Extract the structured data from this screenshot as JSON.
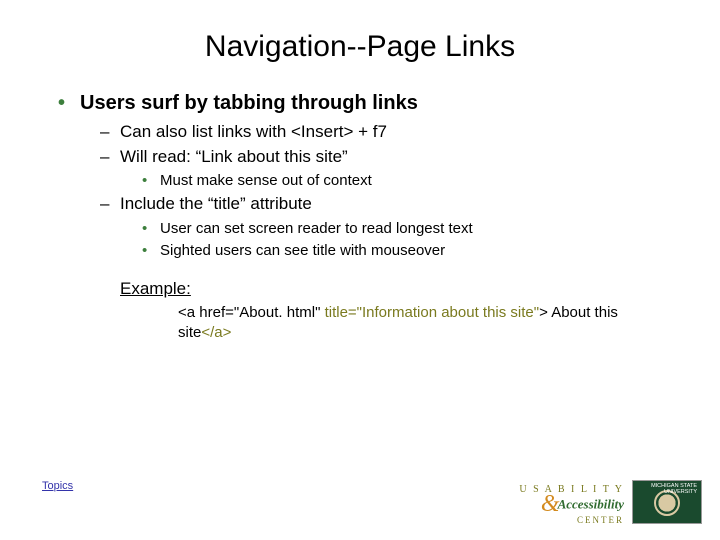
{
  "title": "Navigation--Page Links",
  "bullets": {
    "l1": "Users surf by tabbing through links",
    "l2a": "Can also list links with <Insert> + f7",
    "l2b": "Will read: “Link about this site”",
    "l3a": "Must make sense out of context",
    "l2c": "Include the “title” attribute",
    "l3b": "User can set screen reader to read longest text",
    "l3c": "Sighted users can see title with mouseover"
  },
  "example": {
    "label": "Example:",
    "seg1": "<a href=\"About. html\" ",
    "seg2": "title=\"Information about this site\"",
    "seg3": "> About this site",
    "seg4": "</a>"
  },
  "topics_link": "Topics",
  "logos": {
    "usability": "U S A B I L I T Y",
    "amp": "&",
    "accessibility": "Accessibility",
    "center": "CENTER",
    "msu1": "MICHIGAN STATE",
    "msu2": "UNIVERSITY"
  }
}
